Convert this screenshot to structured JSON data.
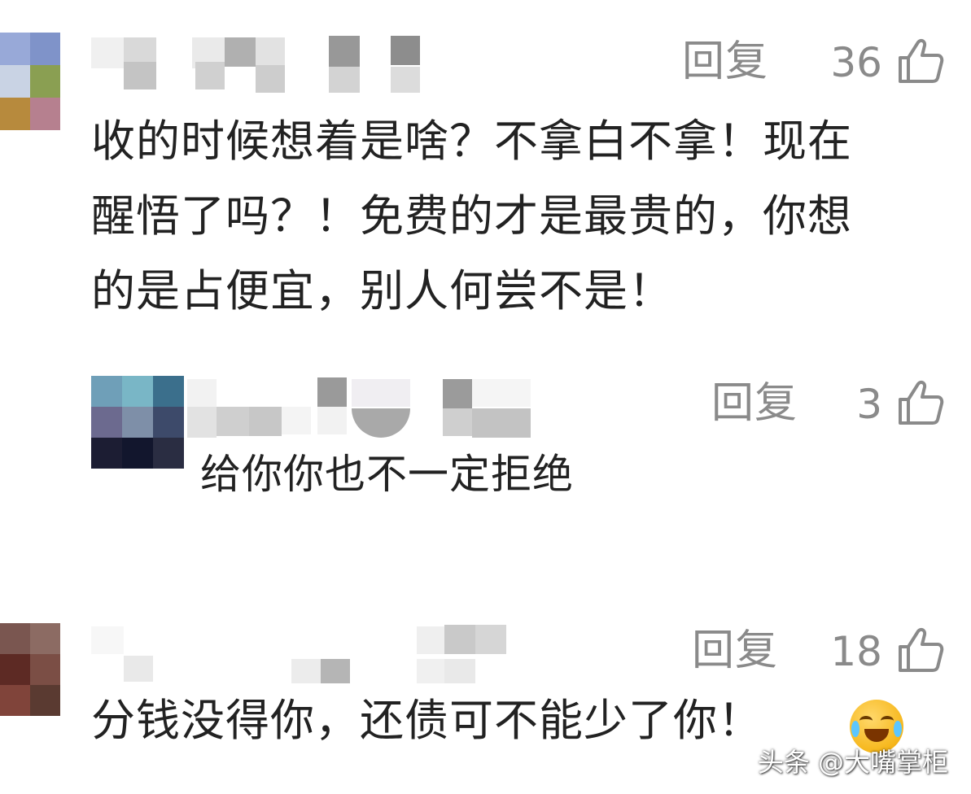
{
  "comments": [
    {
      "reply_label": "回复",
      "like_count": "36",
      "lines": [
        "收的时候想着是啥？不拿白不拿！现在",
        "醒悟了吗？！免费的才是最贵的，你想",
        "的是占便宜，别人何尝不是！"
      ]
    },
    {
      "reply_label": "回复",
      "like_count": "3",
      "text": "给你你也不一定拒绝"
    },
    {
      "reply_label": "回复",
      "like_count": "18",
      "text": "分钱没得你，还债可不能少了你！"
    }
  ],
  "icons": {
    "like": "thumbs-up-icon",
    "emoji": "laughing-crying-face-icon"
  },
  "watermark": "头条 @大嘴掌柜",
  "colors": {
    "meta_text": "#8a8a8a",
    "body_text": "#222222",
    "background": "#ffffff"
  }
}
